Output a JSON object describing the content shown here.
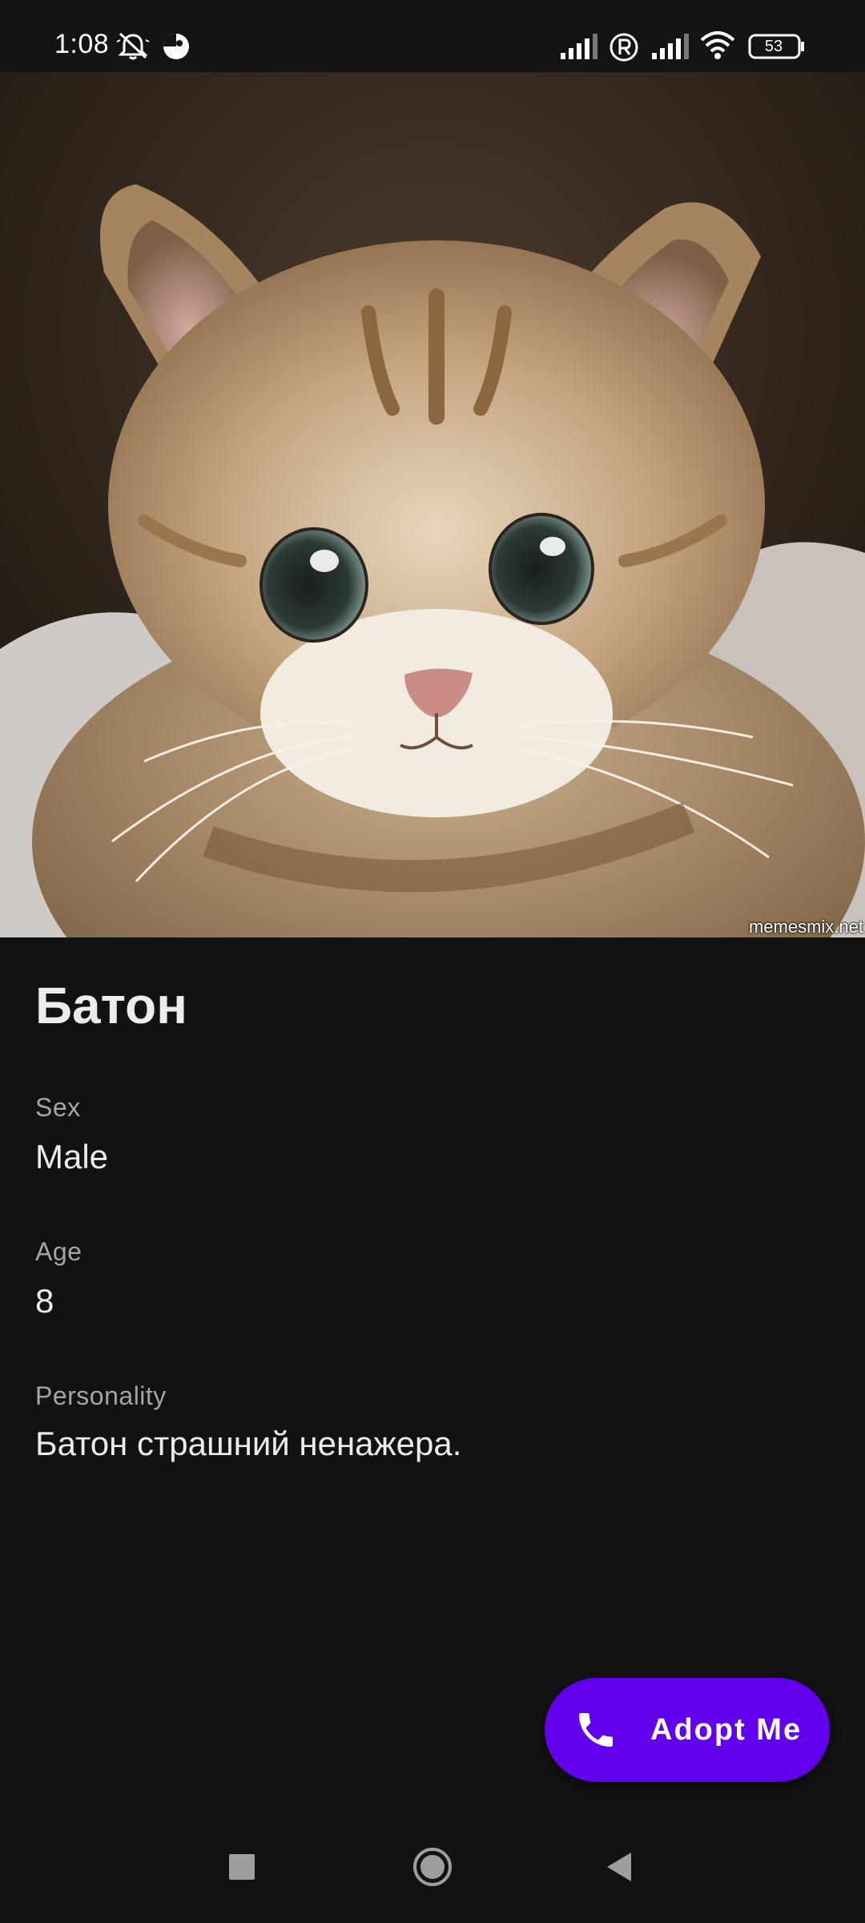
{
  "status_bar": {
    "time": "1:08",
    "battery_level": "53",
    "icons": [
      "mute-icon",
      "app-notification-icon",
      "signal-icon",
      "roaming-icon",
      "signal-icon",
      "wifi-icon",
      "battery-icon"
    ]
  },
  "hero": {
    "subject": "cat-photo",
    "watermark": "memesmix.net"
  },
  "pet": {
    "name": "Батон",
    "fields": [
      {
        "label": "Sex",
        "value": "Male"
      },
      {
        "label": "Age",
        "value": "8"
      },
      {
        "label": "Personality",
        "value": "Батон страшний ненажера."
      }
    ]
  },
  "fab": {
    "label": "Adopt Me",
    "icon": "phone-icon",
    "color": "#6200ee"
  },
  "nav_bar": {
    "buttons": [
      "recents-icon",
      "home-icon",
      "back-icon"
    ]
  },
  "theme": {
    "background": "#121212",
    "text_primary": "#ececec",
    "text_secondary": "#a5a5a5"
  }
}
